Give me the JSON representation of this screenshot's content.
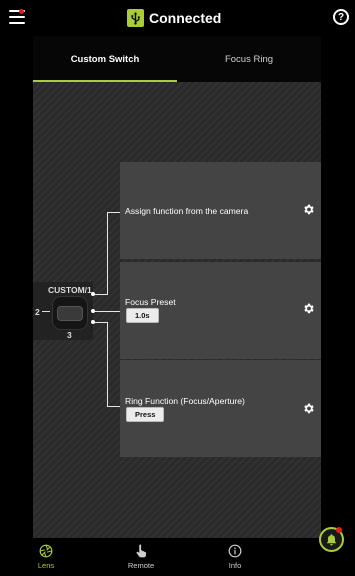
{
  "header": {
    "menu_icon": "hamburger-menu-icon",
    "notification_dot_color": "#e02020",
    "connection_icon": "usb-icon",
    "connection_label": "Connected",
    "help_icon": "help-icon",
    "help_glyph": "?"
  },
  "tabs": [
    {
      "label": "Custom Switch",
      "active": true
    },
    {
      "label": "Focus Ring",
      "active": false
    }
  ],
  "switch": {
    "custom_label": "CUSTOM/1",
    "pos2_label": "2",
    "pos3_label": "3"
  },
  "cards": [
    {
      "title": "Assign function from the camera",
      "button": null,
      "icon": "gear-icon"
    },
    {
      "title": "Focus Preset",
      "button": "1.0s",
      "icon": "gear-icon"
    },
    {
      "title": "Ring Function (Focus/Aperture)",
      "button": "Press",
      "icon": "gear-icon"
    }
  ],
  "bottom_nav": [
    {
      "label": "Lens",
      "icon": "aperture-icon",
      "active": true
    },
    {
      "label": "Remote",
      "icon": "hand-touch-icon",
      "active": false
    },
    {
      "label": "Info",
      "icon": "info-icon",
      "active": false
    }
  ],
  "notification": {
    "icon": "bell-icon"
  },
  "colors": {
    "accent": "#a8cc3c",
    "background": "#000000",
    "card": "#444444",
    "alert": "#e02020"
  }
}
